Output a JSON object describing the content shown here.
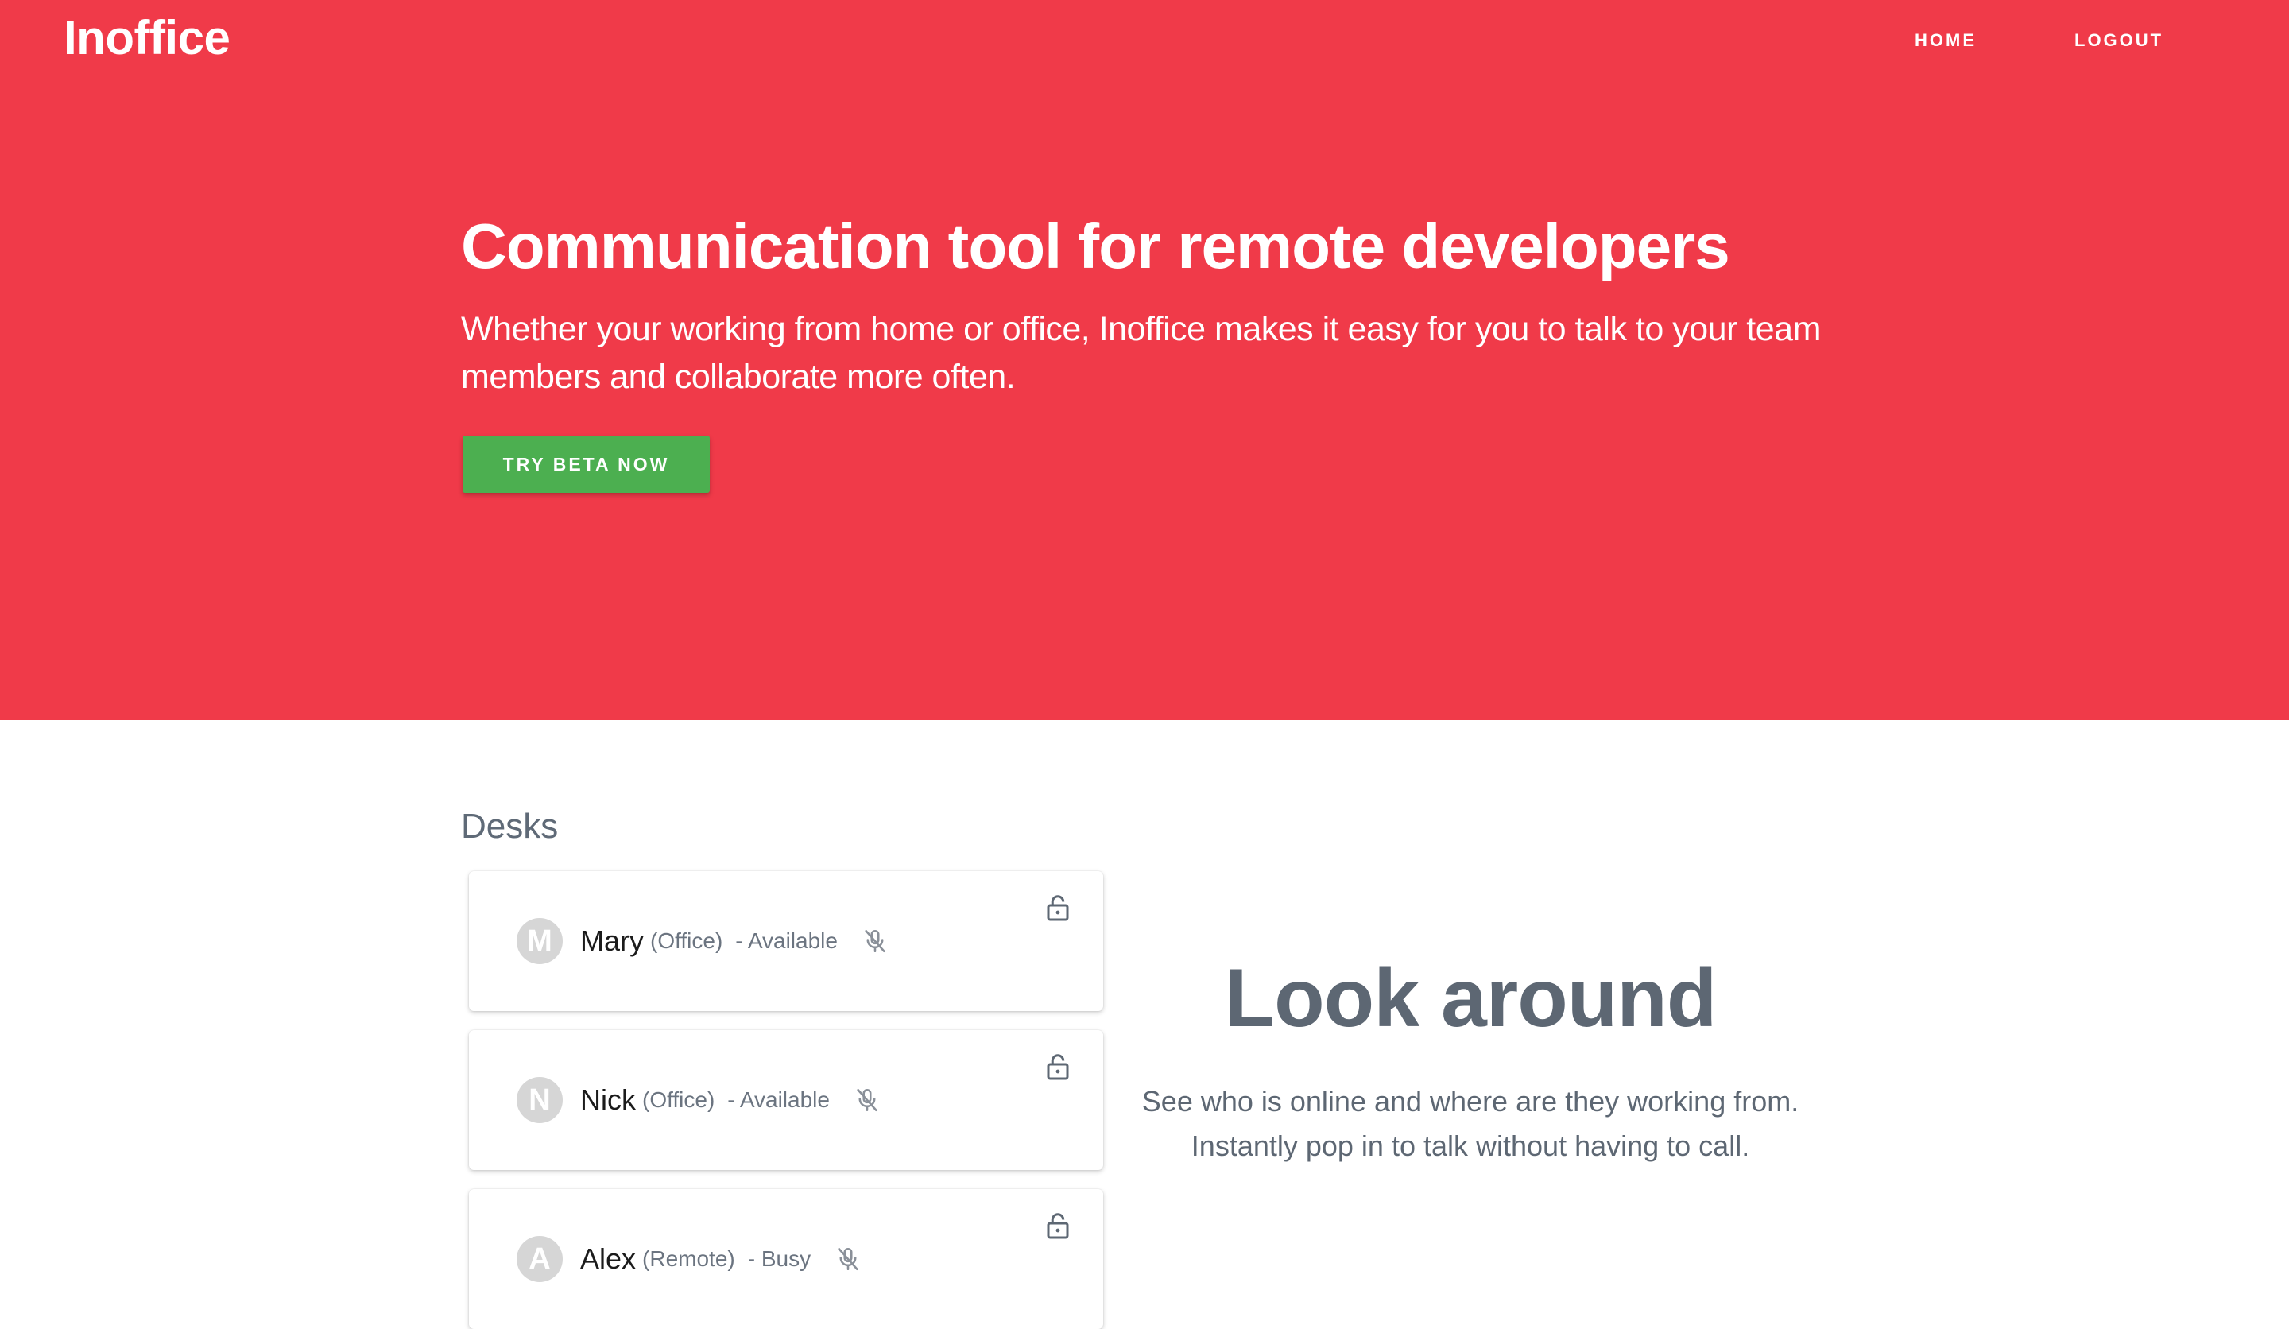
{
  "header": {
    "logo": "Inoffice",
    "nav": {
      "home": "HOME",
      "logout": "LOGOUT"
    }
  },
  "hero": {
    "title": "Communication tool for remote developers",
    "subtitle": "Whether your working from home or office, Inoffice makes it easy for you to talk to your team members and collaborate more often.",
    "cta": "TRY BETA NOW",
    "background_color": "#f03a49",
    "cta_color": "#4caf50"
  },
  "desks": {
    "title": "Desks",
    "items": [
      {
        "initial": "M",
        "name": "Mary",
        "location": "(Office)",
        "status": "- Available",
        "mic_icon": "mic-off-icon",
        "lock_icon": "lock-icon"
      },
      {
        "initial": "N",
        "name": "Nick",
        "location": "(Office)",
        "status": "- Available",
        "mic_icon": "mic-off-icon",
        "lock_icon": "lock-icon"
      },
      {
        "initial": "A",
        "name": "Alex",
        "location": "(Remote)",
        "status": "- Busy",
        "mic_icon": "mic-off-icon",
        "lock_icon": "lock-icon"
      }
    ]
  },
  "feature": {
    "title": "Look around",
    "line1": "See who is online and where are they working from.",
    "line2": "Instantly pop in to talk without having to call."
  }
}
